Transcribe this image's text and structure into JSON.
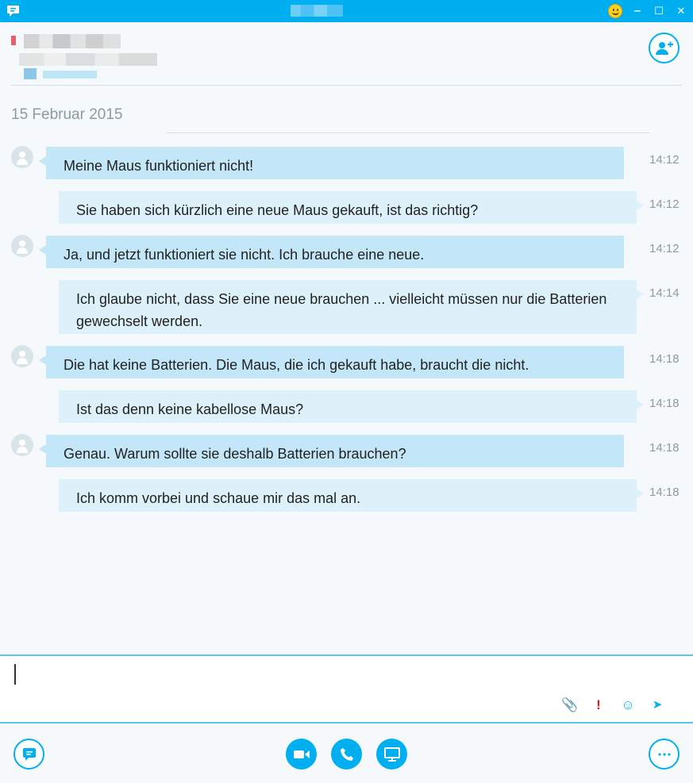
{
  "titlebar": {
    "icons": [
      "skype-logo-icon",
      "smiley-icon",
      "minimize-icon",
      "maximize-icon",
      "close-icon"
    ],
    "controls": {
      "minimize": "–",
      "maximize": "☐",
      "close": "✕"
    }
  },
  "header": {
    "icons": [
      "presence-icon",
      "location-icon",
      "add-contact-icon"
    ]
  },
  "conversation": {
    "date": "15 Februar 2015",
    "messages": [
      {
        "from": "contact",
        "text": "Meine Maus funktioniert nicht!",
        "time": "14:12"
      },
      {
        "from": "me",
        "text": "Sie haben sich kürzlich eine neue Maus gekauft, ist das richtig?",
        "time": "14:12"
      },
      {
        "from": "contact",
        "text": "Ja, und jetzt funktioniert sie nicht. Ich brauche eine neue.",
        "time": "14:12"
      },
      {
        "from": "me",
        "text": "Ich glaube nicht, dass Sie eine neue brauchen ... vielleicht müssen nur die Batterien gewechselt werden.",
        "time": "14:14"
      },
      {
        "from": "contact",
        "text": "Die hat keine Batterien. Die Maus, die ich gekauft habe, braucht die nicht.",
        "time": "14:18"
      },
      {
        "from": "me",
        "text": "Ist das denn keine kabellose Maus?",
        "time": "14:18"
      },
      {
        "from": "contact",
        "text": "Genau. Warum sollte sie deshalb Batterien brauchen?",
        "time": "14:18"
      },
      {
        "from": "me",
        "text": "Ich komm vorbei und schaue mir das mal an.",
        "time": "14:18"
      }
    ]
  },
  "composer": {
    "value": "",
    "tools": {
      "attach": "📎",
      "important": "!",
      "emoticon": "☺",
      "send": "➤"
    }
  },
  "bottom_bar": {
    "icons": [
      "chat-icon",
      "video-call-icon",
      "phone-icon",
      "screen-share-icon",
      "more-icon"
    ]
  },
  "colors": {
    "accent": "#00aff0",
    "incoming_bubble": "#c3e7f8",
    "outgoing_bubble": "#ddf1fb",
    "background": "#f5f9fc"
  }
}
